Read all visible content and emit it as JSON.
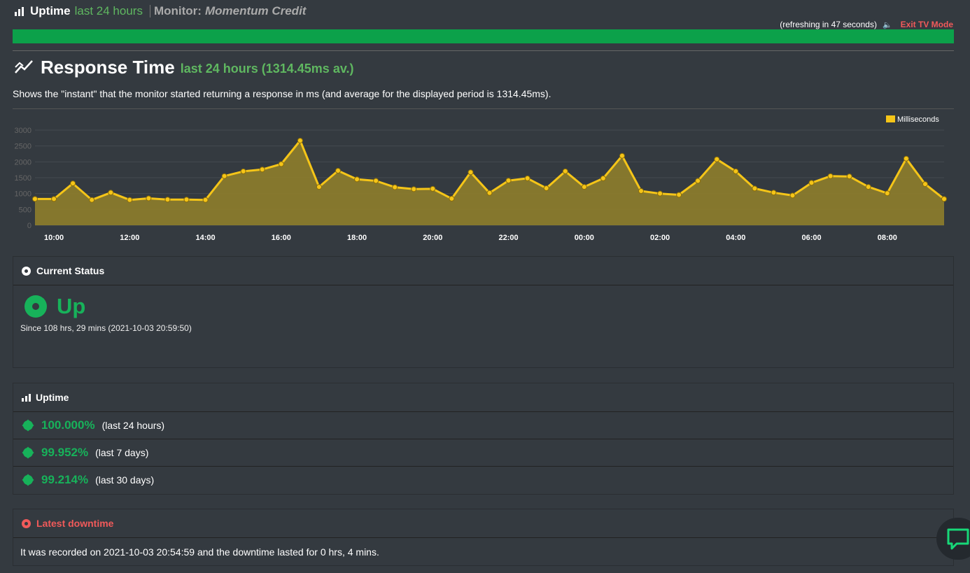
{
  "header": {
    "uptime_label": "Uptime",
    "uptime_period": "last 24 hours",
    "monitor_label": "Monitor:",
    "monitor_name": "Momentum Credit",
    "refresh_text": "(refreshing in 47 seconds)",
    "exit_label": "Exit TV Mode",
    "bar_percent": 100
  },
  "response": {
    "title": "Response Time",
    "subtitle": "last 24 hours (1314.45ms av.)",
    "description": "Shows the \"instant\" that the monitor started returning a response in ms (and average for the displayed period is 1314.45ms)."
  },
  "colors": {
    "accent_green": "#5fb760",
    "status_green": "#17b25a",
    "bar_green": "#0ca14a",
    "chart_yellow": "#f5c518",
    "alert_red": "#f15a5a"
  },
  "chart_data": {
    "type": "area",
    "legend": "Milliseconds",
    "legend_position": "top-right",
    "ylim": [
      0,
      3000
    ],
    "yticks": [
      "0",
      "500",
      "1000",
      "1500",
      "2000",
      "2500",
      "3000"
    ],
    "xticks": [
      "10:00",
      "12:00",
      "14:00",
      "16:00",
      "18:00",
      "20:00",
      "22:00",
      "00:00",
      "02:00",
      "04:00",
      "06:00",
      "08:00"
    ],
    "grid": true,
    "series": [
      {
        "name": "Milliseconds",
        "values": [
          830,
          830,
          1320,
          800,
          1030,
          800,
          850,
          810,
          810,
          800,
          1550,
          1700,
          1760,
          1930,
          2670,
          1210,
          1720,
          1450,
          1400,
          1200,
          1140,
          1150,
          840,
          1670,
          1020,
          1410,
          1480,
          1170,
          1700,
          1210,
          1480,
          2190,
          1080,
          1000,
          960,
          1400,
          2080,
          1700,
          1160,
          1030,
          940,
          1340,
          1550,
          1540,
          1210,
          1010,
          2100,
          1300,
          830
        ]
      }
    ]
  },
  "status": {
    "title": "Current Status",
    "state": "Up",
    "since": "Since 108 hrs, 29 mins (2021-10-03 20:59:50)"
  },
  "uptime": {
    "title": "Uptime",
    "rows": [
      {
        "percent": "100.000%",
        "period": "(last 24 hours)"
      },
      {
        "percent": "99.952%",
        "period": "(last 7 days)"
      },
      {
        "percent": "99.214%",
        "period": "(last 30 days)"
      }
    ]
  },
  "downtime": {
    "title": "Latest downtime",
    "text": "It was recorded on 2021-10-03 20:54:59 and the downtime lasted for 0 hrs, 4 mins."
  }
}
